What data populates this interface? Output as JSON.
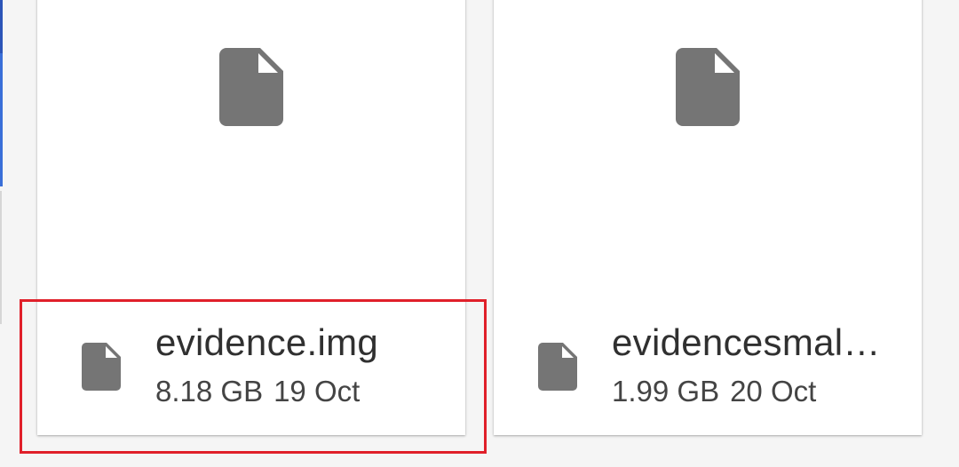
{
  "files": [
    {
      "name": "evidence.img",
      "size": "8.18 GB",
      "date": "19 Oct"
    },
    {
      "name": "evidencesmall.img",
      "size": "1.99 GB",
      "date": "20 Oct"
    }
  ],
  "icons": {
    "file": "file-icon"
  },
  "colors": {
    "icon": "#757575",
    "highlight": "#e0202a",
    "card": "#ffffff",
    "background": "#f5f5f5"
  }
}
